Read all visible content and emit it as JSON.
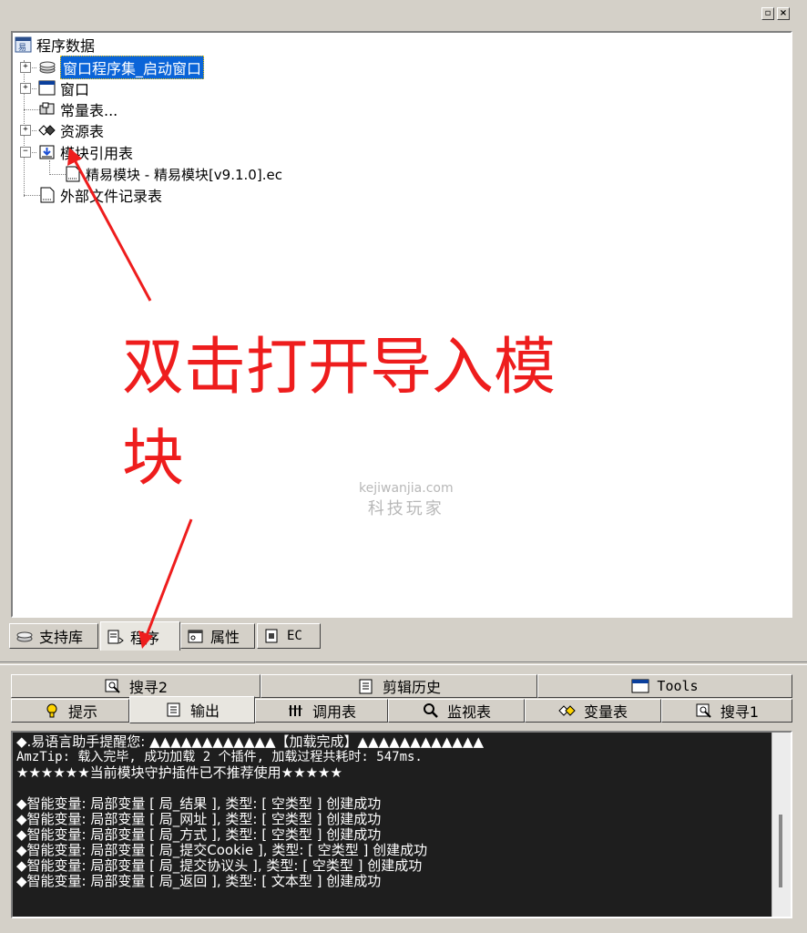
{
  "window": {
    "restore_glyph": "▫",
    "close_glyph": "×"
  },
  "tree": {
    "root_label": "程序数据",
    "items": [
      {
        "label": "窗口程序集_启动窗口",
        "icon": "program-set-icon",
        "expander": "+"
      },
      {
        "label": "窗口",
        "icon": "window-icon",
        "expander": "+"
      },
      {
        "label": "常量表...",
        "icon": "constant-table-icon",
        "expander": ""
      },
      {
        "label": "资源表",
        "icon": "resource-table-icon",
        "expander": "+"
      },
      {
        "label": "模块引用表",
        "icon": "module-table-icon",
        "expander": "−"
      },
      {
        "label": "精易模块 - 精易模块[v9.1.0].ec",
        "icon": "document-icon",
        "expander": ""
      },
      {
        "label": "外部文件记录表",
        "icon": "document-icon",
        "expander": ""
      }
    ]
  },
  "annotation": {
    "line1": "双击打开导入模",
    "line2": "块"
  },
  "watermark": {
    "url": "kejiwanjia.com",
    "name": "科技玩家"
  },
  "lower_tabs": [
    {
      "label": "支持库",
      "icon": "library-icon"
    },
    {
      "label": "程序",
      "icon": "program-icon",
      "active": true
    },
    {
      "label": "属性",
      "icon": "properties-icon"
    },
    {
      "label": "EC",
      "icon": "ec-icon"
    }
  ],
  "bottom_tabs_row1": [
    {
      "label": "搜寻2",
      "icon": "search2-icon"
    },
    {
      "label": "剪辑历史",
      "icon": "clipboard-icon"
    },
    {
      "label": "Tools",
      "icon": "tools-window-icon"
    }
  ],
  "bottom_tabs_row2": [
    {
      "label": "提示",
      "icon": "hint-icon"
    },
    {
      "label": "输出",
      "icon": "output-icon",
      "active": true
    },
    {
      "label": "调用表",
      "icon": "call-table-icon"
    },
    {
      "label": "监视表",
      "icon": "watch-icon"
    },
    {
      "label": "变量表",
      "icon": "variable-table-icon"
    },
    {
      "label": "搜寻1",
      "icon": "search1-icon"
    }
  ],
  "console": {
    "lines": [
      "◆.易语言助手提醒您: ▲▲▲▲▲▲▲▲▲▲▲▲【加载完成】▲▲▲▲▲▲▲▲▲▲▲▲",
      "AmzTip: 载入完毕, 成功加载 2 个插件, 加载过程共耗时: 547ms.",
      "★★★★★★当前模块守护插件已不推荐使用★★★★★",
      "",
      "◆智能变量: 局部变量 [ 局_结果 ], 类型: [ 空类型 ] 创建成功",
      "◆智能变量: 局部变量 [ 局_网址 ], 类型: [ 空类型 ] 创建成功",
      "◆智能变量: 局部变量 [ 局_方式 ], 类型: [ 空类型 ] 创建成功",
      "◆智能变量: 局部变量 [ 局_提交Cookie ], 类型: [ 空类型 ] 创建成功",
      "◆智能变量: 局部变量 [ 局_提交协议头 ], 类型: [ 空类型 ] 创建成功",
      "◆智能变量: 局部变量 [ 局_返回 ], 类型: [ 文本型 ] 创建成功"
    ]
  },
  "colors": {
    "annotation_red": "#ee1d1d",
    "selection_blue": "#0a64d8",
    "console_bg": "#1e1e1e"
  }
}
